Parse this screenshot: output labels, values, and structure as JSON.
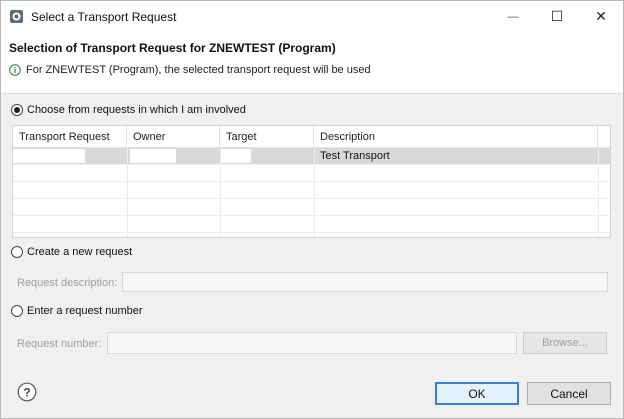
{
  "window": {
    "title": "Select a Transport Request",
    "controls": {
      "minimize": "—",
      "maximize": "☐",
      "close": "✕"
    }
  },
  "header": {
    "title": "Selection of Transport Request for ZNEWTEST (Program)",
    "message": "For ZNEWTEST (Program), the selected transport request will be used"
  },
  "options": {
    "choose": {
      "label": "Choose from requests in which I am involved",
      "checked": true
    },
    "create": {
      "label": "Create a new request",
      "checked": false
    },
    "enter": {
      "label": "Enter a request number",
      "checked": false
    }
  },
  "table": {
    "columns": [
      "Transport Request",
      "Owner",
      "Target",
      "Description"
    ],
    "rows": [
      {
        "transport_request": "",
        "owner": "",
        "target": "",
        "description": "Test Transport",
        "selected": true
      }
    ]
  },
  "fields": {
    "request_description": {
      "label": "Request description:",
      "value": "",
      "disabled": true
    },
    "request_number": {
      "label": "Request number:",
      "value": "",
      "disabled": true
    }
  },
  "buttons": {
    "browse": "Browse...",
    "ok": "OK",
    "cancel": "Cancel"
  },
  "icons": {
    "app": "sap-transport-icon",
    "info": "info-icon",
    "help": "help-icon"
  },
  "colors": {
    "accent": "#3c7fd6",
    "selected_row": "#d9d9d9",
    "info_icon": "#2e7d32"
  }
}
